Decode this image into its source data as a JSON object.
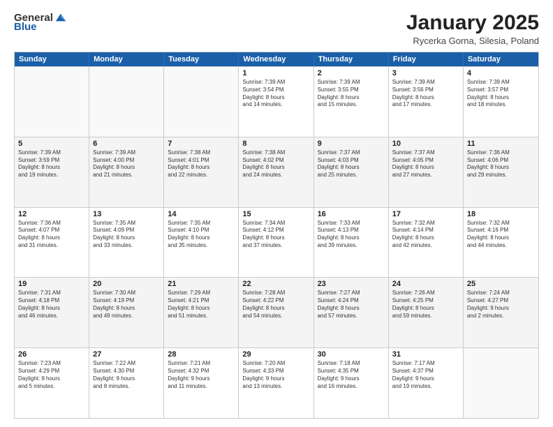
{
  "logo": {
    "general": "General",
    "blue": "Blue"
  },
  "header": {
    "month": "January 2025",
    "location": "Rycerka Gorna, Silesia, Poland"
  },
  "weekdays": [
    "Sunday",
    "Monday",
    "Tuesday",
    "Wednesday",
    "Thursday",
    "Friday",
    "Saturday"
  ],
  "rows": [
    [
      {
        "day": "",
        "info": ""
      },
      {
        "day": "",
        "info": ""
      },
      {
        "day": "",
        "info": ""
      },
      {
        "day": "1",
        "info": "Sunrise: 7:39 AM\nSunset: 3:54 PM\nDaylight: 8 hours\nand 14 minutes."
      },
      {
        "day": "2",
        "info": "Sunrise: 7:39 AM\nSunset: 3:55 PM\nDaylight: 8 hours\nand 15 minutes."
      },
      {
        "day": "3",
        "info": "Sunrise: 7:39 AM\nSunset: 3:56 PM\nDaylight: 8 hours\nand 17 minutes."
      },
      {
        "day": "4",
        "info": "Sunrise: 7:39 AM\nSunset: 3:57 PM\nDaylight: 8 hours\nand 18 minutes."
      }
    ],
    [
      {
        "day": "5",
        "info": "Sunrise: 7:39 AM\nSunset: 3:59 PM\nDaylight: 8 hours\nand 19 minutes."
      },
      {
        "day": "6",
        "info": "Sunrise: 7:39 AM\nSunset: 4:00 PM\nDaylight: 8 hours\nand 21 minutes."
      },
      {
        "day": "7",
        "info": "Sunrise: 7:38 AM\nSunset: 4:01 PM\nDaylight: 8 hours\nand 22 minutes."
      },
      {
        "day": "8",
        "info": "Sunrise: 7:38 AM\nSunset: 4:02 PM\nDaylight: 8 hours\nand 24 minutes."
      },
      {
        "day": "9",
        "info": "Sunrise: 7:37 AM\nSunset: 4:03 PM\nDaylight: 8 hours\nand 25 minutes."
      },
      {
        "day": "10",
        "info": "Sunrise: 7:37 AM\nSunset: 4:05 PM\nDaylight: 8 hours\nand 27 minutes."
      },
      {
        "day": "11",
        "info": "Sunrise: 7:36 AM\nSunset: 4:06 PM\nDaylight: 8 hours\nand 29 minutes."
      }
    ],
    [
      {
        "day": "12",
        "info": "Sunrise: 7:36 AM\nSunset: 4:07 PM\nDaylight: 8 hours\nand 31 minutes."
      },
      {
        "day": "13",
        "info": "Sunrise: 7:35 AM\nSunset: 4:09 PM\nDaylight: 8 hours\nand 33 minutes."
      },
      {
        "day": "14",
        "info": "Sunrise: 7:35 AM\nSunset: 4:10 PM\nDaylight: 8 hours\nand 35 minutes."
      },
      {
        "day": "15",
        "info": "Sunrise: 7:34 AM\nSunset: 4:12 PM\nDaylight: 8 hours\nand 37 minutes."
      },
      {
        "day": "16",
        "info": "Sunrise: 7:33 AM\nSunset: 4:13 PM\nDaylight: 8 hours\nand 39 minutes."
      },
      {
        "day": "17",
        "info": "Sunrise: 7:32 AM\nSunset: 4:14 PM\nDaylight: 8 hours\nand 42 minutes."
      },
      {
        "day": "18",
        "info": "Sunrise: 7:32 AM\nSunset: 4:16 PM\nDaylight: 8 hours\nand 44 minutes."
      }
    ],
    [
      {
        "day": "19",
        "info": "Sunrise: 7:31 AM\nSunset: 4:18 PM\nDaylight: 8 hours\nand 46 minutes."
      },
      {
        "day": "20",
        "info": "Sunrise: 7:30 AM\nSunset: 4:19 PM\nDaylight: 8 hours\nand 49 minutes."
      },
      {
        "day": "21",
        "info": "Sunrise: 7:29 AM\nSunset: 4:21 PM\nDaylight: 8 hours\nand 51 minutes."
      },
      {
        "day": "22",
        "info": "Sunrise: 7:28 AM\nSunset: 4:22 PM\nDaylight: 8 hours\nand 54 minutes."
      },
      {
        "day": "23",
        "info": "Sunrise: 7:27 AM\nSunset: 4:24 PM\nDaylight: 8 hours\nand 57 minutes."
      },
      {
        "day": "24",
        "info": "Sunrise: 7:26 AM\nSunset: 4:25 PM\nDaylight: 8 hours\nand 59 minutes."
      },
      {
        "day": "25",
        "info": "Sunrise: 7:24 AM\nSunset: 4:27 PM\nDaylight: 9 hours\nand 2 minutes."
      }
    ],
    [
      {
        "day": "26",
        "info": "Sunrise: 7:23 AM\nSunset: 4:29 PM\nDaylight: 9 hours\nand 5 minutes."
      },
      {
        "day": "27",
        "info": "Sunrise: 7:22 AM\nSunset: 4:30 PM\nDaylight: 9 hours\nand 8 minutes."
      },
      {
        "day": "28",
        "info": "Sunrise: 7:21 AM\nSunset: 4:32 PM\nDaylight: 9 hours\nand 11 minutes."
      },
      {
        "day": "29",
        "info": "Sunrise: 7:20 AM\nSunset: 4:33 PM\nDaylight: 9 hours\nand 13 minutes."
      },
      {
        "day": "30",
        "info": "Sunrise: 7:18 AM\nSunset: 4:35 PM\nDaylight: 9 hours\nand 16 minutes."
      },
      {
        "day": "31",
        "info": "Sunrise: 7:17 AM\nSunset: 4:37 PM\nDaylight: 9 hours\nand 19 minutes."
      },
      {
        "day": "",
        "info": ""
      }
    ]
  ]
}
